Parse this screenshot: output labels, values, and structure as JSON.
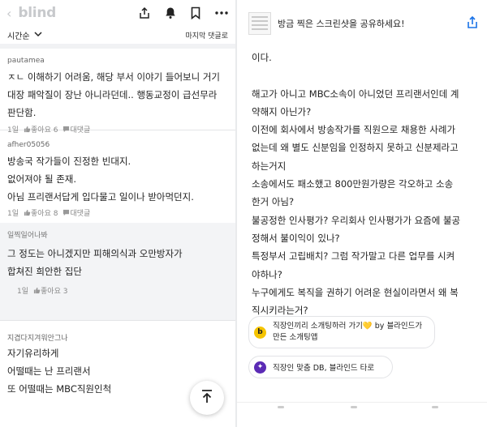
{
  "left": {
    "app_name": "blind",
    "sort": {
      "label": "시간순"
    },
    "last_comment_label": "마지막 댓글로",
    "comments": [
      {
        "author": "pautamea",
        "text": "ㅈㄴ 이해하기 어려움, 해당 부서 이야기 들어보니 거기\n대장 패악질이 장난 아니라던데.. 행동교정이 급선무라\n판단함.",
        "time": "1일",
        "like": "좋아요 6",
        "reply": "대댓글"
      },
      {
        "author": "afher05056",
        "text": "방송국 작가들이 진정한 빈대지.\n없어져야 될 존재.\n아님 프리랜서답게 입다물고 일이나 받아먹던지.",
        "time": "1일",
        "like": "좋아요 8",
        "reply": "대댓글"
      }
    ],
    "reply_comment": {
      "author": "일찍일어나봐",
      "text": "그 정도는 아니겠지만 피해의식과 오만방자가\n합쳐진 희안한 집단",
      "time": "1일",
      "like": "좋아요 3"
    },
    "last_comment": {
      "author": "지겹다지겨워안그나",
      "text": "자기유리하게\n어떨때는 난 프리랜서\n또 어떨때는 MBC직원인척"
    }
  },
  "right": {
    "share_banner": "방금 찍은 스크린샷을 공유하세요!",
    "post_text": "이다.\n\n해고가 아니고 MBC소속이 아니었던 프리랜서인데 계\n약해지 아닌가?\n이전에 회사에서 방송작가를 직원으로 채용한 사례가\n없는데 왜 별도 신분임을 인정하지 못하고 신분제라고\n하는거지\n소송에서도 패소했고 800만원가량은 각오하고 소송\n한거 아님?\n불공정한 인사평가? 우리회사 인사평가가 요즘에 불공\n정해서 불이익이 있나?\n특정부서 고립배치? 그럼 작가말고 다른 업무를 시켜\n야하나?\n누구에게도 복직을 권하기 어려운 현실이라면서 왜 복\n직시키라는거?",
    "promo1": {
      "badge": "b",
      "text": "직장인끼리 소개팅하러 가기💛 by 블라인드가\n만든 소개팅앱"
    },
    "promo2": {
      "badge": "✦",
      "text": "직장인 맞춤 DB, 블라인드 타로"
    }
  },
  "colors": {
    "promo1_badge": "#f5c400",
    "promo2_badge": "#5b2bb5"
  }
}
